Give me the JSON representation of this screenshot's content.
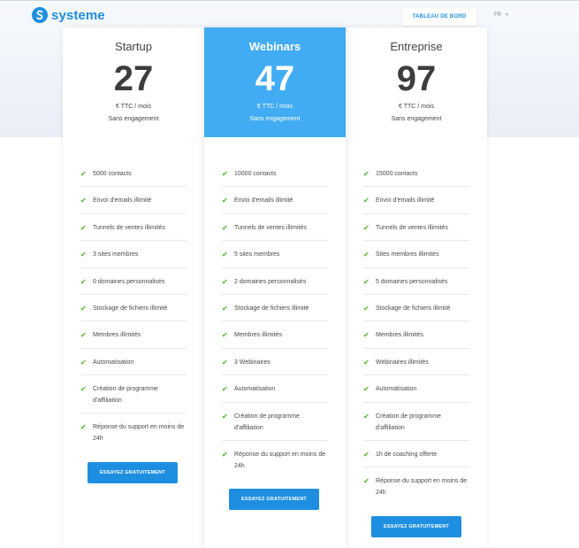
{
  "header": {
    "logo_text": "systeme",
    "dashboard_button": "TABLEAU DE BORD",
    "language": "FR"
  },
  "plans": [
    {
      "name": "Startup",
      "price": "27",
      "price_unit": "€ TTC / mois",
      "billing": "Sans engagement",
      "features": [
        "5000 contacts",
        "Envoi d'emails illimité",
        "Tunnels de ventes illimités",
        "3 sites membres",
        "0 domaines personnalisés",
        "Stockage de fichiers illimité",
        "Membres illimités",
        "Automatisation",
        "Création de programme d'affiliation",
        "Réponse du support en moins de 24h"
      ],
      "cta": "ESSAYEZ GRATUITEMENT"
    },
    {
      "name": "Webinars",
      "price": "47",
      "price_unit": "€ TTC / mois",
      "billing": "Sans engagement",
      "features": [
        "10000 contacts",
        "Envoi d'emails illimité",
        "Tunnels de ventes illimités",
        "5 sites membres",
        "2 domaines personnalisés",
        "Stockage de fichiers illimité",
        "Membres illimités",
        "3 Webinaires",
        "Automatisation",
        "Création de programme d'affiliation",
        "Réponse du support en moins de 24h"
      ],
      "cta": "ESSAYEZ GRATUITEMENT"
    },
    {
      "name": "Entreprise",
      "price": "97",
      "price_unit": "€ TTC / mois",
      "billing": "Sans engagement",
      "features": [
        "15000 contacts",
        "Envoi d'emails illimité",
        "Tunnels de ventes illimités",
        "Sites membres illimités",
        "5 domaines personnalisés",
        "Stockage de fichiers illimité",
        "Membres illimités",
        "Webinaires illimités",
        "Automatisation",
        "Création de programme d'affiliation",
        "1h de coaching offerte",
        "Réponse du support en moins de 24h"
      ],
      "cta": "ESSAYEZ GRATUITEMENT"
    }
  ],
  "colors": {
    "brand_blue": "#1e8fe0",
    "highlight_blue": "#41acf3",
    "check_green": "#6cc04a"
  }
}
